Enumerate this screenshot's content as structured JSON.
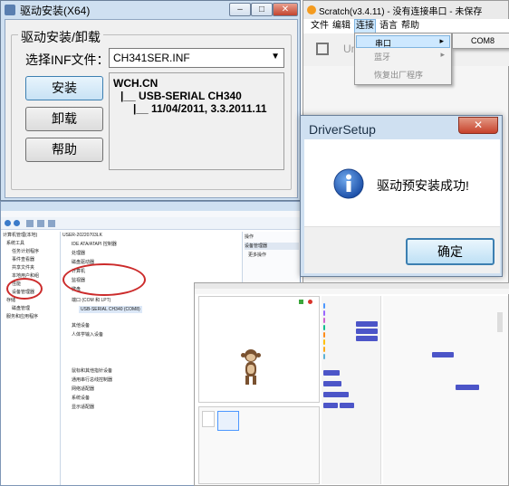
{
  "driver_window": {
    "title": "驱动安装(X64)",
    "group_label": "驱动安装/卸载",
    "inf_label": "选择INF文件：",
    "inf_value": "CH341SER.INF",
    "install_label": "安装",
    "uninstall_label": "卸载",
    "help_label": "帮助",
    "info_lines": [
      "WCH.CN",
      "|__ USB-SERIAL CH340",
      "|__ 11/04/2011, 3.3.2011.11"
    ]
  },
  "scratch_window": {
    "title": "Scratch(v3.4.11) - 没有连接串口 - 未保存",
    "menu": [
      "文件",
      "编辑",
      "连接",
      "语言",
      "帮助"
    ],
    "connect_menu": {
      "items": [
        "串口",
        "蓝牙",
        "恢复出厂程序"
      ],
      "submenu": "COM8"
    },
    "partial_text": "Un"
  },
  "dialog": {
    "title": "DriverSetup",
    "message": "驱动预安装成功!",
    "ok_label": "确定",
    "close_glyph": "✕"
  },
  "device_manager": {
    "left_tree": [
      "计算机管理(本地)",
      "系统工具",
      "任务计划程序",
      "事件查看器",
      "共享文件夹",
      "本地用户和组",
      "性能",
      "设备管理器",
      "存储",
      "磁盘管理",
      "服务和应用程序"
    ],
    "right_tree": [
      "USER-20220703LK",
      "IDE ATA/ATAPI 控制器",
      "处理器",
      "磁盘驱动器",
      "计算机",
      "监视器",
      "键盘",
      "端口 (COM 和 LPT)",
      "USB-SERIAL CH340 (COM8)",
      "其他设备",
      "人体学输入设备",
      "鼠标和其他指针设备",
      "通用串行总线控制器",
      "网络适配器",
      "系统设备",
      "显示适配器"
    ],
    "ops_header": "操作",
    "ops_items": [
      "设备管理器",
      "更多操作"
    ]
  },
  "colors": {
    "dialog_title": "#1a2f45",
    "dialog_bg": "#ffffff",
    "win7_frame": "#cfe0f1",
    "close_red": "#c7422b",
    "highlight": "#cc2b2b",
    "scratch_block": "#4c55c8",
    "menu_hover": "#cde8ff"
  },
  "icons": {
    "info": "info-icon",
    "dropdown": "chevron-down-icon",
    "close": "close-icon"
  }
}
